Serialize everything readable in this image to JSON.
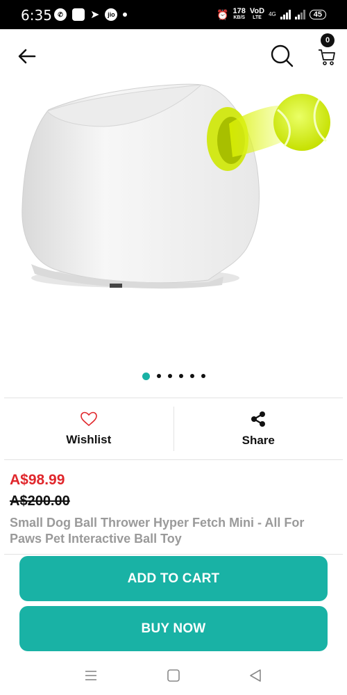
{
  "status_bar": {
    "time": "6:35",
    "speed_value": "178",
    "speed_unit": "KB/S",
    "network": "4G",
    "battery": "45"
  },
  "header": {
    "cart_count": "0"
  },
  "carousel": {
    "total": 6,
    "active": 0
  },
  "actions": {
    "wishlist_label": "Wishlist",
    "share_label": "Share"
  },
  "product": {
    "price_current": "A$98.99",
    "price_original": "A$200.00",
    "title": "Small Dog Ball Thrower Hyper Fetch Mini - All For Paws Pet Interactive Ball Toy"
  },
  "buttons": {
    "add_to_cart": "ADD TO CART",
    "buy_now": "BUY NOW"
  },
  "colors": {
    "accent": "#19b2a5",
    "price": "#e0262b"
  }
}
